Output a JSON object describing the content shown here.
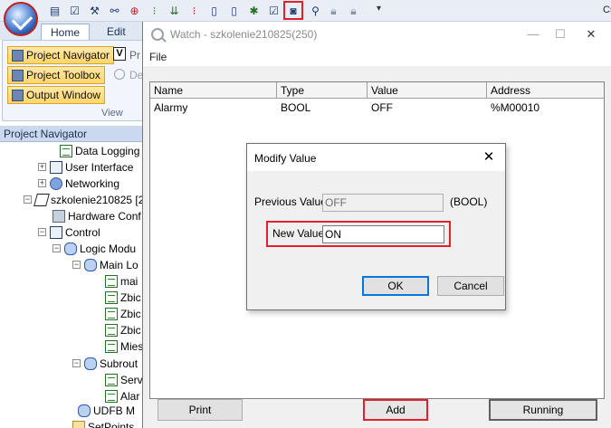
{
  "toolbar": {
    "icons": [
      "save-icon",
      "checklist-icon",
      "tools-icon",
      "link-icon",
      "target-icon",
      "traffic-light-icon",
      "download-icon",
      "traffic-light-icon",
      "book-icon",
      "book-icon",
      "bug-icon",
      "check-doc-icon",
      "watch-icon",
      "magnifier-icon",
      "lock-icon",
      "lock-icon"
    ],
    "more": "▾",
    "cut_text": "Cs"
  },
  "ribbon": {
    "tabs": [
      "Home",
      "Edit"
    ],
    "active_tab": "Home",
    "buttons": {
      "project_navigator": "Project Navigator",
      "project_toolbox": "Project Toolbox",
      "output_window": "Output Window"
    },
    "cut_labels": {
      "pr": "Pr",
      "de": "De"
    },
    "group_label": "View"
  },
  "navigator": {
    "header": "Project Navigator",
    "tree": [
      {
        "label": "Data Logging",
        "icon": "doc-icon",
        "expander": ""
      },
      {
        "label": "User Interface",
        "icon": "monitor-icon",
        "expander": "+"
      },
      {
        "label": "Networking",
        "icon": "network-icon",
        "expander": "+"
      },
      {
        "label": "szkolenie210825 [2",
        "icon": "project-icon",
        "expander": "−"
      },
      {
        "label": "Hardware Conf",
        "icon": "hardware-icon",
        "expander": ""
      },
      {
        "label": "Control",
        "icon": "monitor-icon",
        "expander": "−"
      },
      {
        "label": "Logic Modu",
        "icon": "group-icon",
        "expander": "−"
      },
      {
        "label": "Main Lo",
        "icon": "group-icon",
        "expander": "−"
      },
      {
        "label": "mai",
        "icon": "doc-icon",
        "expander": ""
      },
      {
        "label": "Zbic",
        "icon": "doc-icon",
        "expander": ""
      },
      {
        "label": "Zbic",
        "icon": "doc-icon",
        "expander": ""
      },
      {
        "label": "Zbic",
        "icon": "doc-icon",
        "expander": ""
      },
      {
        "label": "Mies",
        "icon": "doc-icon",
        "expander": ""
      },
      {
        "label": "Subrout",
        "icon": "group-icon",
        "expander": "−"
      },
      {
        "label": "Serv",
        "icon": "doc-icon",
        "expander": ""
      },
      {
        "label": "Alar",
        "icon": "doc-icon",
        "expander": ""
      },
      {
        "label": "UDFB M",
        "icon": "group-icon",
        "expander": ""
      },
      {
        "label": "SetPoints",
        "icon": "folder-icon",
        "expander": ""
      }
    ]
  },
  "watch": {
    "title": "Watch - szkolenie210825(250)",
    "window_controls": [
      "—",
      "☐",
      "✕"
    ],
    "menu": [
      "File"
    ],
    "columns": [
      "Name",
      "Type",
      "Value",
      "Address"
    ],
    "rows": [
      {
        "name": "Alarmy",
        "type": "BOOL",
        "value": "OFF",
        "address": "%M00010"
      }
    ],
    "buttons": {
      "print": "Print",
      "add": "Add",
      "running": "Running"
    }
  },
  "dialog": {
    "title": "Modify Value",
    "close": "✕",
    "previous_value_label": "Previous Value:",
    "previous_value": "OFF",
    "type_hint": "(BOOL)",
    "new_value_label": "New Value:",
    "new_value": "ON",
    "ok": "OK",
    "cancel": "Cancel"
  },
  "colors": {
    "highlight": "#e0202a",
    "ribbon_button": "#ffd46a",
    "focus_border": "#0078d7"
  }
}
